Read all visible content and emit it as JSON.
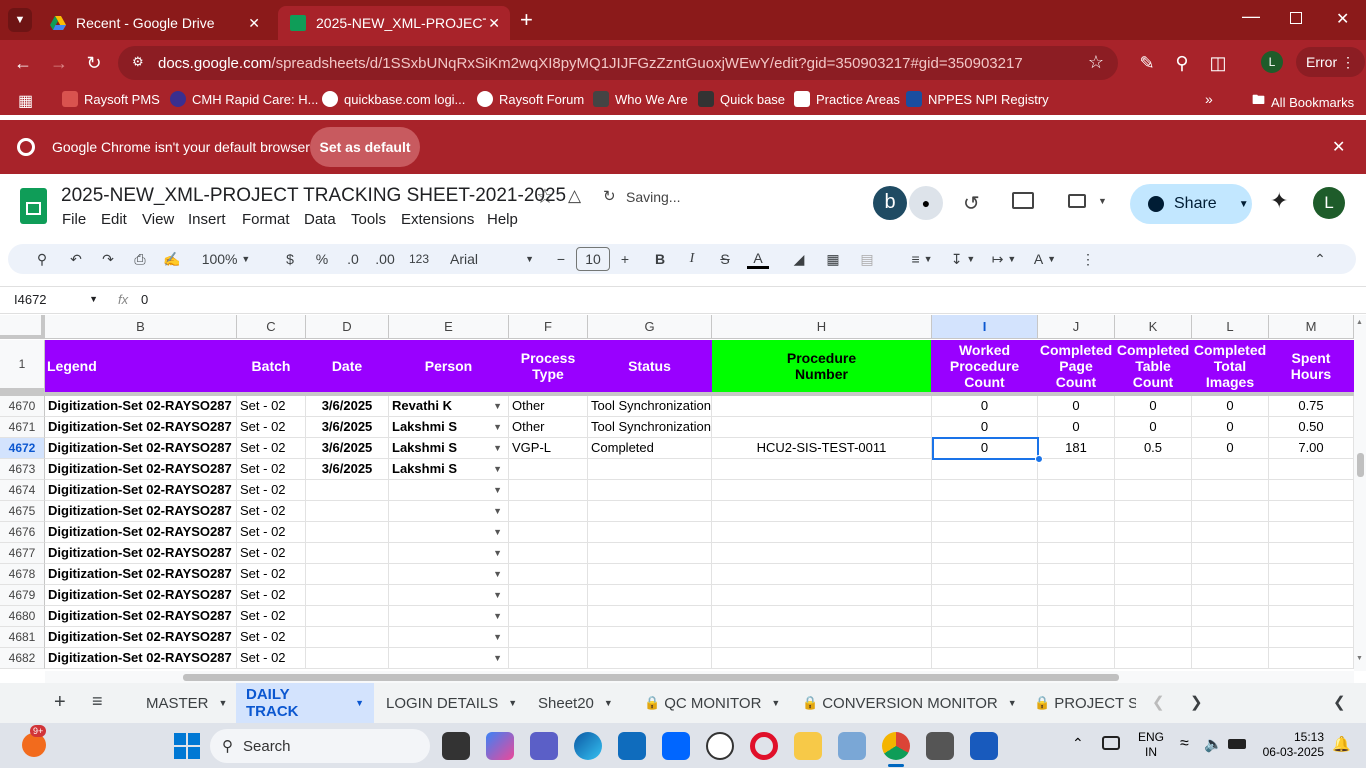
{
  "browser": {
    "tabs": [
      {
        "title": "Recent - Google Drive"
      },
      {
        "title": "2025-NEW_XML-PROJECT TRAC"
      }
    ],
    "url_host": "docs.google.com",
    "url_path": "/spreadsheets/d/1SSxbUNqRxSiKm2wqXI8pyMQ1JIJFGzZzntGuoxjWEwY/edit?gid=350903217#gid=350903217",
    "profile_initial": "L",
    "error_label": "Error",
    "bookmarks": [
      "Raysoft PMS",
      "CMH Rapid Care: H...",
      "quickbase.com logi...",
      "Raysoft Forum",
      "Who We Are",
      "Quick base",
      "Practice Areas",
      "NPPES NPI Registry"
    ],
    "all_bookmarks": "All Bookmarks",
    "infobar_text": "Google Chrome isn't your default browser",
    "set_default_label": "Set as default"
  },
  "sheet": {
    "title": "2025-NEW_XML-PROJECT TRACKING SHEET-2021-2025",
    "saving": "Saving...",
    "avatar_b": "b",
    "share_label": "Share",
    "user_initial": "L",
    "menus": [
      "File",
      "Edit",
      "View",
      "Insert",
      "Format",
      "Data",
      "Tools",
      "Extensions",
      "Help"
    ],
    "zoom": "100%",
    "currency": "$",
    "percent": "%",
    "dec_less": ".0",
    "dec_more": ".00",
    "num_fmt": "123",
    "font": "Arial",
    "font_size": "10",
    "cell_ref": "I4672",
    "formula_value": "0",
    "fx": "fx"
  },
  "grid": {
    "columns": [
      "B",
      "C",
      "D",
      "E",
      "F",
      "G",
      "H",
      "I",
      "J",
      "K",
      "L",
      "M"
    ],
    "header_row_num": "1",
    "header": [
      "Legend",
      "Batch",
      "Date",
      "Person",
      "Process\nType",
      "Status",
      "Procedure\nNumber",
      "Worked\nProcedure\nCount",
      "Completed\nPage\nCount",
      "Completed\nTable\nCount",
      "Completed\nTotal\nImages",
      "Spent\nHours"
    ],
    "rows": [
      {
        "num": "4670",
        "B": "Digitization-Set 02-RAYSO287",
        "C": "Set - 02",
        "D": "3/6/2025",
        "E": "Revathi K",
        "F": "Other",
        "G": "Tool Synchronization",
        "H": "",
        "I": "0",
        "J": "0",
        "K": "0",
        "L": "0",
        "M": "0.75"
      },
      {
        "num": "4671",
        "B": "Digitization-Set 02-RAYSO287",
        "C": "Set - 02",
        "D": "3/6/2025",
        "E": "Lakshmi S",
        "F": "Other",
        "G": "Tool Synchronization",
        "H": "",
        "I": "0",
        "J": "0",
        "K": "0",
        "L": "0",
        "M": "0.50"
      },
      {
        "num": "4672",
        "B": "Digitization-Set 02-RAYSO287",
        "C": "Set - 02",
        "D": "3/6/2025",
        "E": "Lakshmi S",
        "F": "VGP-L",
        "G": "Completed",
        "H": "HCU2-SIS-TEST-0011",
        "I": "0",
        "J": "181",
        "K": "0.5",
        "L": "0",
        "M": "7.00"
      },
      {
        "num": "4673",
        "B": "Digitization-Set 02-RAYSO287",
        "C": "Set - 02",
        "D": "3/6/2025",
        "E": "Lakshmi S",
        "F": "",
        "G": "",
        "H": "",
        "I": "",
        "J": "",
        "K": "",
        "L": "",
        "M": ""
      },
      {
        "num": "4674",
        "B": "Digitization-Set 02-RAYSO287",
        "C": "Set - 02",
        "D": "",
        "E": "",
        "F": "",
        "G": "",
        "H": "",
        "I": "",
        "J": "",
        "K": "",
        "L": "",
        "M": ""
      },
      {
        "num": "4675",
        "B": "Digitization-Set 02-RAYSO287",
        "C": "Set - 02",
        "D": "",
        "E": "",
        "F": "",
        "G": "",
        "H": "",
        "I": "",
        "J": "",
        "K": "",
        "L": "",
        "M": ""
      },
      {
        "num": "4676",
        "B": "Digitization-Set 02-RAYSO287",
        "C": "Set - 02",
        "D": "",
        "E": "",
        "F": "",
        "G": "",
        "H": "",
        "I": "",
        "J": "",
        "K": "",
        "L": "",
        "M": ""
      },
      {
        "num": "4677",
        "B": "Digitization-Set 02-RAYSO287",
        "C": "Set - 02",
        "D": "",
        "E": "",
        "F": "",
        "G": "",
        "H": "",
        "I": "",
        "J": "",
        "K": "",
        "L": "",
        "M": ""
      },
      {
        "num": "4678",
        "B": "Digitization-Set 02-RAYSO287",
        "C": "Set - 02",
        "D": "",
        "E": "",
        "F": "",
        "G": "",
        "H": "",
        "I": "",
        "J": "",
        "K": "",
        "L": "",
        "M": ""
      },
      {
        "num": "4679",
        "B": "Digitization-Set 02-RAYSO287",
        "C": "Set - 02",
        "D": "",
        "E": "",
        "F": "",
        "G": "",
        "H": "",
        "I": "",
        "J": "",
        "K": "",
        "L": "",
        "M": ""
      },
      {
        "num": "4680",
        "B": "Digitization-Set 02-RAYSO287",
        "C": "Set - 02",
        "D": "",
        "E": "",
        "F": "",
        "G": "",
        "H": "",
        "I": "",
        "J": "",
        "K": "",
        "L": "",
        "M": ""
      },
      {
        "num": "4681",
        "B": "Digitization-Set 02-RAYSO287",
        "C": "Set - 02",
        "D": "",
        "E": "",
        "F": "",
        "G": "",
        "H": "",
        "I": "",
        "J": "",
        "K": "",
        "L": "",
        "M": ""
      },
      {
        "num": "4682",
        "B": "Digitization-Set 02-RAYSO287",
        "C": "Set - 02",
        "D": "",
        "E": "",
        "F": "",
        "G": "",
        "H": "",
        "I": "",
        "J": "",
        "K": "",
        "L": "",
        "M": ""
      }
    ],
    "selected_row": "4672",
    "selected_col": "I"
  },
  "sheet_tabs": [
    "MASTER",
    "DAILY TRACK",
    "LOGIN DETAILS",
    "Sheet20",
    "QC MONITOR",
    "CONVERSION MONITOR",
    "PROJECT SU"
  ],
  "active_sheet_tab": "DAILY TRACK",
  "taskbar": {
    "search_label": "Search",
    "notif_badge": "9+",
    "lang": "ENG",
    "lang_region": "IN",
    "time": "15:13",
    "date": "06-03-2025"
  },
  "colors": {
    "chrome_red": "#a8232a",
    "header_purple": "#9900ff",
    "header_green": "#00ff00",
    "share_bg": "#c2e7ff",
    "sheets_green": "#0f9d58"
  }
}
